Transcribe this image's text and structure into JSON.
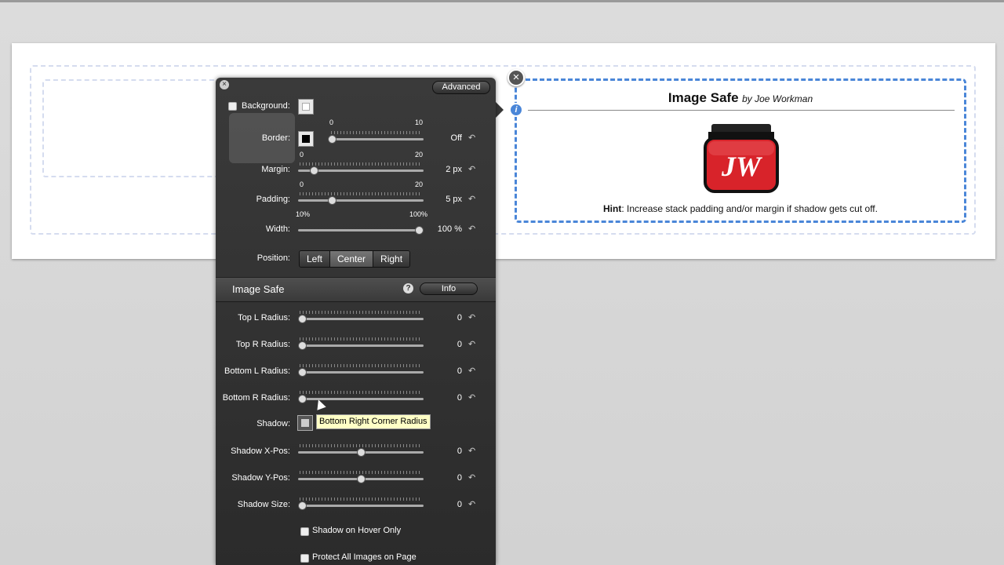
{
  "stack_preview": {
    "title": "Image Safe",
    "byline": "by Joe Workman",
    "logo_text": "JW",
    "hint_label": "Hint",
    "hint_text": ": Increase stack padding and/or margin if shadow gets cut off."
  },
  "panel": {
    "close_glyph": "×",
    "advanced_label": "Advanced",
    "background": {
      "label": "Background:",
      "checked": false
    },
    "border": {
      "label": "Border:",
      "scale_min": "0",
      "scale_max": "10",
      "value": "Off",
      "color": "#000000"
    },
    "margin": {
      "label": "Margin:",
      "scale_min": "0",
      "scale_max": "20",
      "value": "2 px",
      "fraction": 0.1
    },
    "padding": {
      "label": "Padding:",
      "scale_min": "0",
      "scale_max": "20",
      "value": "5 px",
      "fraction": 0.25
    },
    "width": {
      "label": "Width:",
      "scale_min": "10%",
      "scale_max": "100%",
      "value": "100 %",
      "fraction": 1.0
    },
    "position": {
      "label": "Position:",
      "options": [
        "Left",
        "Center",
        "Right"
      ],
      "selected": "Center"
    },
    "section": {
      "title": "Image Safe",
      "help_glyph": "?",
      "info_label": "Info"
    },
    "sliders": [
      {
        "label": "Top L Radius:",
        "value": "0",
        "fraction": 0
      },
      {
        "label": "Top R Radius:",
        "value": "0",
        "fraction": 0
      },
      {
        "label": "Bottom L Radius:",
        "value": "0",
        "fraction": 0
      },
      {
        "label": "Bottom R Radius:",
        "value": "0",
        "fraction": 0
      }
    ],
    "shadow": {
      "label": "Shadow:"
    },
    "shadow_sliders": [
      {
        "label": "Shadow X-Pos:",
        "value": "0",
        "fraction": 0.5
      },
      {
        "label": "Shadow Y-Pos:",
        "value": "0",
        "fraction": 0.5
      },
      {
        "label": "Shadow Size:",
        "value": "0",
        "fraction": 0
      }
    ],
    "checkboxes": [
      {
        "label": "Shadow on Hover Only",
        "checked": false
      },
      {
        "label": "Protect All Images on Page",
        "checked": false
      }
    ],
    "tooltip": "Bottom Right Corner Radius",
    "reset_glyph": "↶"
  },
  "colors": {
    "accent": "#4a86d8",
    "logo_red": "#d8232a"
  }
}
